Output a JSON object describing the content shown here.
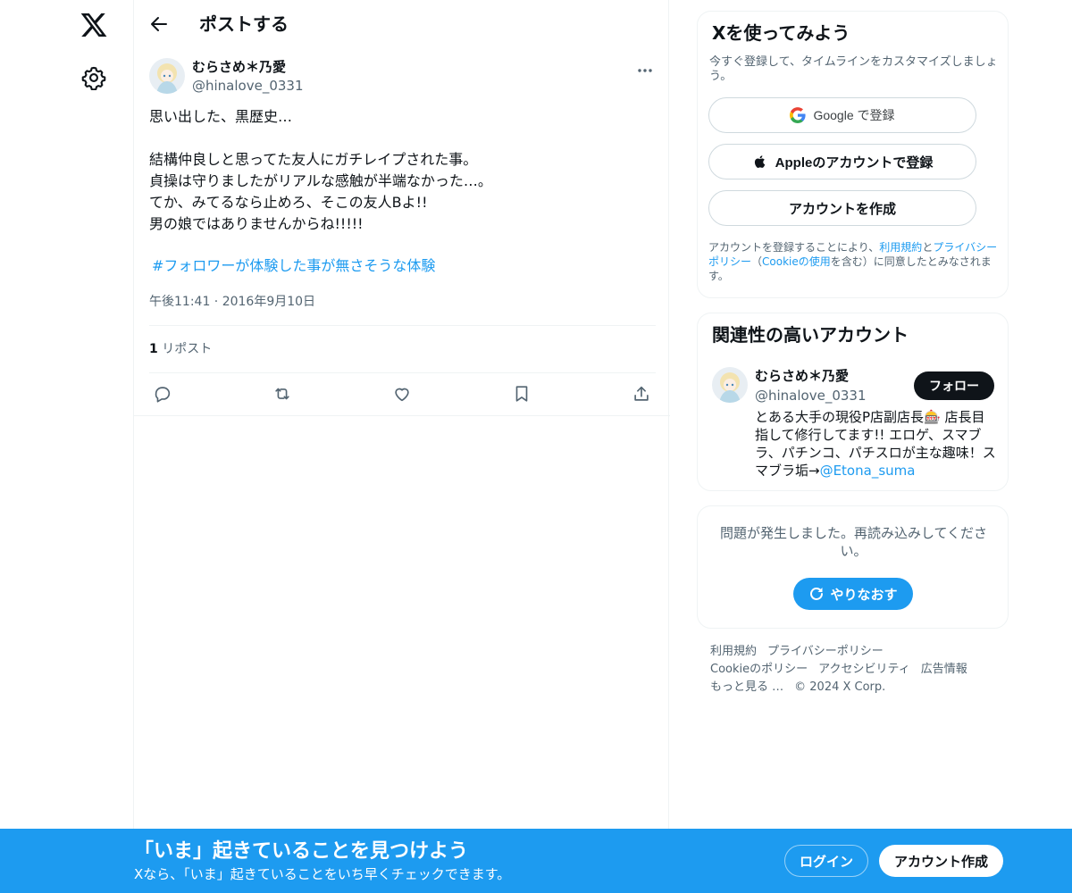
{
  "colors": {
    "accent": "#1d9bf0",
    "text": "#0f1419",
    "muted": "#536471",
    "border": "#eff3f4"
  },
  "nav": {
    "logo_icon": "x-logo-icon",
    "settings_icon": "gear-icon"
  },
  "header": {
    "title": "ポストする",
    "back_icon": "arrow-left-icon"
  },
  "post": {
    "author_name": "むらさめ＊乃愛",
    "author_handle": "@hinalove_0331",
    "text": "思い出した、黒歴史…\n\n結構仲良しと思ってた友人にガチレイプされた事。\n貞操は守りましたがリアルな感触が半端なかった…。\nてか、みてるなら止めろ、そこの友人Bよ!!\n男の娘ではありませんからね!!!!!",
    "hashtag": "#フォロワーが体験した事が無さそうな体験",
    "timestamp": "午後11:41 · 2016年9月10日",
    "repost_count": "1",
    "repost_label": "リポスト",
    "actions": [
      "reply-icon",
      "repost-icon",
      "like-icon",
      "bookmark-icon",
      "share-icon"
    ]
  },
  "signup_card": {
    "title": "Xを使ってみよう",
    "subtitle": "今すぐ登録して、タイムラインをカスタマイズしましょう。",
    "google_label": "Google で登録",
    "apple_label": "Appleのアカウントで登録",
    "create_label": "アカウントを作成",
    "legal_prefix": "アカウントを登録することにより、",
    "legal_terms": "利用規約",
    "legal_and": "と",
    "legal_privacy": "プライバシーポリシー",
    "legal_paren_open": "（",
    "legal_cookie": "Cookieの使用",
    "legal_suffix": "を含む）に同意したとみなされます。"
  },
  "related_card": {
    "title": "関連性の高いアカウント",
    "name": "むらさめ＊乃愛",
    "handle": "@hinalove_0331",
    "follow_label": "フォロー",
    "bio": "とある大手の現役P店副店長🎰 店長目指して修行してます!! エロゲ、スマブラ、パチンコ、パチスロが主な趣味！スマブラ垢→",
    "bio_link": "@Etona_suma"
  },
  "error_card": {
    "message": "問題が発生しました。再読み込みしてください。",
    "retry_label": "やりなおす"
  },
  "footer": {
    "links": [
      "利用規約",
      "プライバシーポリシー",
      "Cookieのポリシー",
      "アクセシビリティ",
      "広告情報",
      "もっと見る …",
      "© 2024 X Corp."
    ]
  },
  "banner": {
    "title": "「いま」起きていることを見つけよう",
    "subtitle": "Xなら、「いま」起きていることをいち早くチェックできます。",
    "login_label": "ログイン",
    "signup_label": "アカウント作成"
  }
}
